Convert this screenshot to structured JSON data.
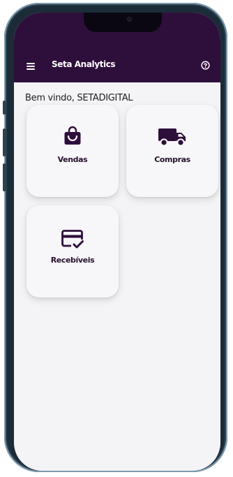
{
  "app": {
    "title": "Seta Analytics",
    "menu_icon": "menu-icon",
    "help_icon": "help-circle-icon",
    "primary_color": "#2e0f3b"
  },
  "welcome_text": "Bem vindo, SETADIGITAL",
  "cards": [
    {
      "label": "Vendas",
      "icon": "shopping-bag-icon"
    },
    {
      "label": "Compras",
      "icon": "truck-icon"
    },
    {
      "label": "Recebíveis",
      "icon": "card-check-icon"
    }
  ]
}
